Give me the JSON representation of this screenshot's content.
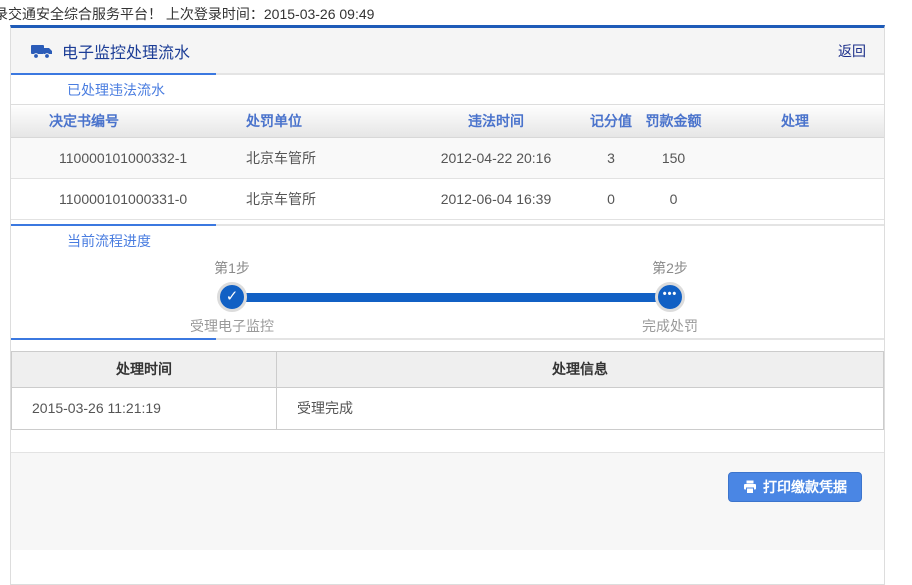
{
  "topbar": {
    "welcome_text": "录交通安全综合服务平台！ 上次登录时间：2015-03-26 09:49"
  },
  "panel": {
    "title": "电子监控处理流水",
    "back_label": "返回",
    "accent_color": "#1e5bb8"
  },
  "tabs": {
    "processed_violations": "已处理违法流水",
    "current_progress": "当前流程进度"
  },
  "violations_table": {
    "headers": [
      "决定书编号",
      "处罚单位",
      "违法时间",
      "记分值",
      "罚款金额",
      "处理"
    ],
    "rows": [
      [
        "110000101000332-1",
        "北京车管所",
        "2012-04-22 20:16",
        "3",
        "150",
        ""
      ],
      [
        "110000101000331-0",
        "北京车管所",
        "2012-06-04 16:39",
        "0",
        "0",
        ""
      ]
    ]
  },
  "progress": {
    "bar_color": "#1160c4",
    "steps": [
      {
        "label": "第1步",
        "sub": "受理电子监控",
        "state": "done",
        "glyph": "✓"
      },
      {
        "label": "第2步",
        "sub": "完成处罚",
        "state": "pending",
        "glyph": "•••"
      }
    ]
  },
  "process_table": {
    "headers": [
      "处理时间",
      "处理信息"
    ],
    "rows": [
      [
        "2015-03-26 11:21:19",
        "受理完成"
      ]
    ]
  },
  "footer": {
    "print_button_label": "打印缴款凭据"
  }
}
